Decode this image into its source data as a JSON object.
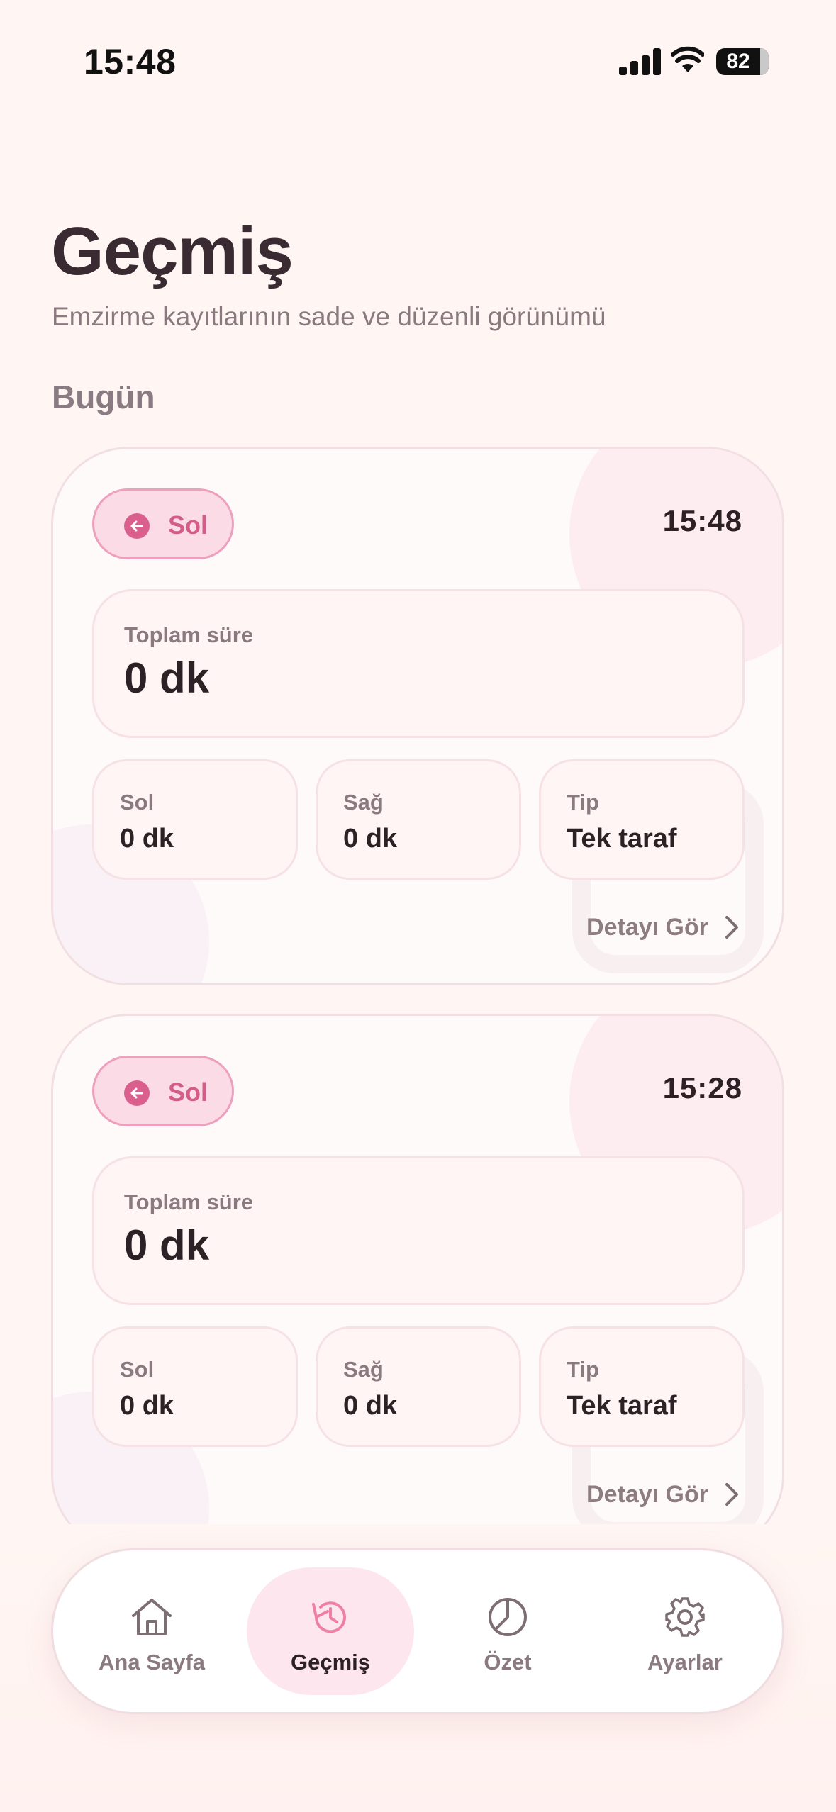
{
  "status_bar": {
    "time": "15:48",
    "battery": "82"
  },
  "header": {
    "title": "Geçmiş",
    "subtitle": "Emzirme kayıtlarının sade ve düzenli görünümü"
  },
  "section": {
    "label": "Bugün"
  },
  "entries": [
    {
      "side": "Sol",
      "time": "15:48",
      "total_label": "Toplam süre",
      "total_value": "0 dk",
      "stats": [
        {
          "label": "Sol",
          "value": "0 dk"
        },
        {
          "label": "Sağ",
          "value": "0 dk"
        },
        {
          "label": "Tip",
          "value": "Tek taraf"
        }
      ],
      "detail_label": "Detayı Gör"
    },
    {
      "side": "Sol",
      "time": "15:28",
      "total_label": "Toplam süre",
      "total_value": "0 dk",
      "stats": [
        {
          "label": "Sol",
          "value": "0 dk"
        },
        {
          "label": "Sağ",
          "value": "0 dk"
        },
        {
          "label": "Tip",
          "value": "Tek taraf"
        }
      ],
      "detail_label": "Detayı Gör"
    }
  ],
  "nav": {
    "items": [
      {
        "label": "Ana Sayfa",
        "icon": "home-icon"
      },
      {
        "label": "Geçmiş",
        "icon": "history-icon",
        "active": true
      },
      {
        "label": "Özet",
        "icon": "pie-chart-icon"
      },
      {
        "label": "Ayarlar",
        "icon": "gear-icon"
      }
    ]
  },
  "colors": {
    "background": "#fff6f3",
    "accent": "#db5f8d",
    "text_dark": "#2d2126",
    "text_muted": "#8a7a80"
  }
}
